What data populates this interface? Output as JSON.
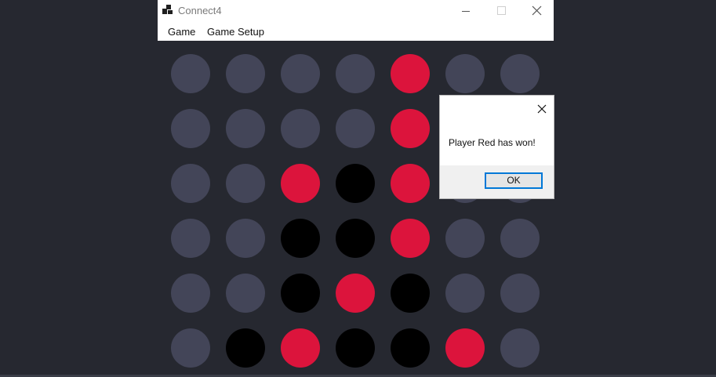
{
  "window": {
    "title": "Connect4",
    "controls": {
      "minimize_icon": "minimize-icon",
      "maximize_icon": "maximize-icon",
      "close_icon": "close-icon"
    }
  },
  "menu": {
    "items": [
      {
        "label": "Game"
      },
      {
        "label": "Game Setup"
      }
    ]
  },
  "colors": {
    "empty": "#434558",
    "red": "#dc143c",
    "black": "#000000",
    "board_bg": "#262830"
  },
  "board": {
    "columns": 7,
    "rows": [
      [
        "empty",
        "empty",
        "empty",
        "empty",
        "red",
        "empty",
        "empty"
      ],
      [
        "empty",
        "empty",
        "empty",
        "empty",
        "red",
        "empty",
        "empty"
      ],
      [
        "empty",
        "empty",
        "red",
        "black",
        "red",
        "empty",
        "empty"
      ],
      [
        "empty",
        "empty",
        "black",
        "black",
        "red",
        "empty",
        "empty"
      ],
      [
        "empty",
        "empty",
        "black",
        "red",
        "black",
        "empty",
        "empty"
      ],
      [
        "empty",
        "black",
        "red",
        "black",
        "black",
        "red",
        "empty"
      ]
    ]
  },
  "dialog": {
    "message": "Player Red has won!",
    "ok_label": "OK",
    "close_icon": "close-icon"
  }
}
